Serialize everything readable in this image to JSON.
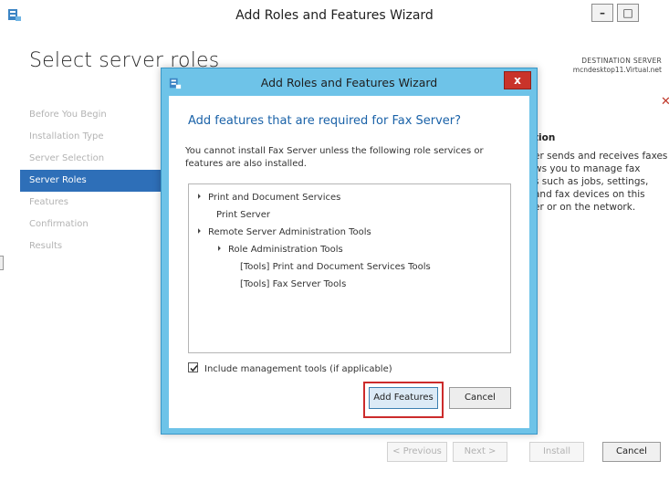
{
  "outer": {
    "title": "Add Roles and Features Wizard",
    "edge_text": [
      "tion",
      "I",
      "nl"
    ],
    "window_buttons": [
      "–",
      "□"
    ],
    "page_heading": "Select server roles",
    "destination_label": "DESTINATION SERVER",
    "destination_value": "mcndesktop11.Virtual.net",
    "nav_items": [
      {
        "label": "Before You Begin",
        "active": false
      },
      {
        "label": "Installation Type",
        "active": false
      },
      {
        "label": "Server Selection",
        "active": false
      },
      {
        "label": "Server Roles",
        "active": true
      },
      {
        "label": "Features",
        "active": false
      },
      {
        "label": "Confirmation",
        "active": false
      },
      {
        "label": "Results",
        "active": false
      }
    ],
    "description": {
      "heading": "tion",
      "lines": [
        "er sends and receives faxes",
        "ws you to manage fax",
        "s such as jobs, settings,",
        "and fax devices on this",
        "er or on the network."
      ]
    },
    "footer": {
      "previous": "< Previous",
      "next": "Next >",
      "install": "Install",
      "cancel": "Cancel"
    }
  },
  "dialog": {
    "title": "Add Roles and Features Wizard",
    "close": "x",
    "heading": "Add features that are required for Fax Server?",
    "text": "You cannot install Fax Server unless the following role services or features are also installed.",
    "tree": [
      {
        "label": "Print and Document Services",
        "level": 0,
        "expanded": true
      },
      {
        "label": "Print Server",
        "level": 1,
        "expanded": false
      },
      {
        "label": "Remote Server Administration Tools",
        "level": 0,
        "expanded": true
      },
      {
        "label": "Role Administration Tools",
        "level": 1,
        "expanded": true
      },
      {
        "label": "[Tools] Print and Document Services Tools",
        "level": 2,
        "expanded": false
      },
      {
        "label": "[Tools] Fax Server Tools",
        "level": 2,
        "expanded": false
      }
    ],
    "include_tools_label": "Include management tools (if applicable)",
    "include_tools_checked": true,
    "add_features_label": "Add Features",
    "cancel_label": "Cancel"
  },
  "colors": {
    "dialog_frame": "#6ec3e8",
    "accent": "#2e6fb8",
    "heading_blue": "#1a62a8",
    "highlight": "#cc2b2b",
    "close_red": "#c9332a"
  }
}
